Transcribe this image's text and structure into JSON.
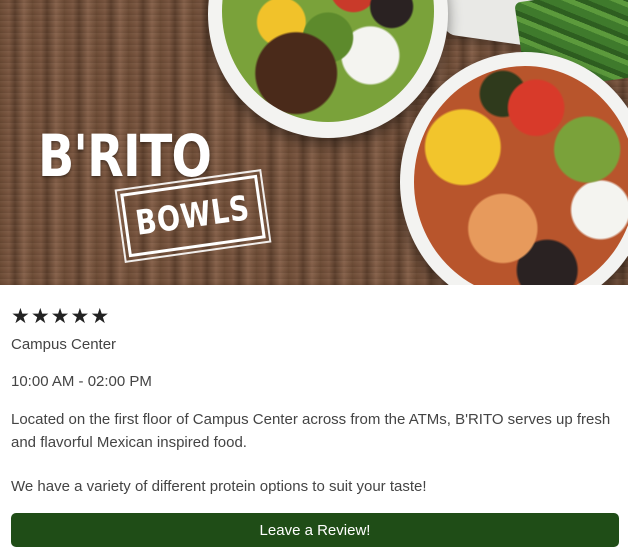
{
  "hero": {
    "logo_title": "B'RITO",
    "logo_stamp": "BOWLS"
  },
  "rating": {
    "stars": [
      "★",
      "★",
      "★",
      "★",
      "★"
    ],
    "value": 5,
    "max": 5
  },
  "location": "Campus Center",
  "hours": "10:00 AM - 02:00 PM",
  "description": "Located on the first floor of Campus Center across from the ATMs, B'RITO serves up fresh and flavorful Mexican inspired food.",
  "description_2": "We have a variety of different protein options to suit your taste!",
  "review_button": {
    "label": "Leave a Review!",
    "color": "#1f4d17"
  }
}
